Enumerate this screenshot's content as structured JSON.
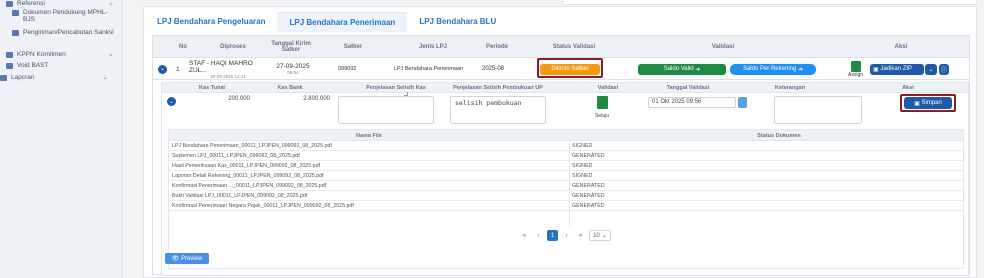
{
  "sidebar": {
    "items": [
      {
        "label": "Referensi",
        "has_chevron": true
      },
      {
        "label": "Dokumen Pendukung MPHL-BJS",
        "sub": true
      },
      {
        "label": "Pengiriman/Pencabutan Sanksi",
        "sub": true
      },
      {
        "label": "KPPN Komitmen",
        "has_chevron": true
      },
      {
        "label": "Void BAST"
      },
      {
        "label": "Lapcran",
        "has_chevron": true
      }
    ]
  },
  "tabs": [
    {
      "label": "LPJ Bendahara Pengeluaran",
      "active": false
    },
    {
      "label": "LPJ Bendahara Penerimaan",
      "active": true
    },
    {
      "label": "LPJ Bendahara BLU",
      "active": false
    }
  ],
  "main_table": {
    "headers": {
      "no": "No",
      "diproses": "Diproses",
      "tanggal_kirim": "Tanggal Kirim Satker",
      "satker": "Satker",
      "jenis_lpj": "Jenis LPJ",
      "periode": "Periode",
      "status_validasi": "Status Validasi",
      "validasi": "Validasi",
      "aksi": "Aksi"
    },
    "row": {
      "no": "1",
      "diproses_name": "STAF - HAQI MAHRO ZUL...",
      "diproses_date": "30-09-2025 14:41",
      "tanggal_kirim_date": "27-09-2025",
      "tanggal_kirim_time": "09:54",
      "satker": "099092",
      "jenis_lpj": "LPJ Bendahara Penerimaan",
      "periode": "2025-08",
      "status_validasi": "Dikirim Satker",
      "saldo_valid_btn": "Saldo Valid",
      "saldo_rekening_btn": "Saldo Per Rekening",
      "assign_label": "Assign",
      "jadikan_zip_btn": "Jadikan ZIP"
    }
  },
  "detail": {
    "headers": {
      "kas_tunai": "Kas Tunai",
      "kas_bank": "Kas Bank",
      "penjelasan_kas": "Penjelasan Selisih Kas",
      "penjelasan_up": "Penjelasan Selisih Pembukuan UP",
      "validasi": "Validasi",
      "tanggal_validasi": "Tanggal Validasi",
      "keterangan": "Keterangan",
      "aksi": "Aksi"
    },
    "row": {
      "kas_tunai": "200.000",
      "kas_bank": "2.800.000",
      "penjelasan_kas": "",
      "penjelasan_up": "selisih pembukuan",
      "validasi_label": "Setuju",
      "tanggal_validasi": "01 Okt 2025 09:56",
      "keterangan": "",
      "simpan_btn": "Simpan"
    }
  },
  "files": {
    "header_nama": "Nama File",
    "header_status": "Status Dokumen",
    "rows": [
      {
        "name": "LPJ Bendahara Penerimaan_00011_LPJPEN_099092_08_2025.pdf",
        "status": "SIGNED"
      },
      {
        "name": "Suplemen LPJ_00011_LPJPEN_099092_08_2025.pdf",
        "status": "GENERATED"
      },
      {
        "name": "Hasil Pemeriksaan Kas_00011_LPJPEN_099092_08_2025.pdf",
        "status": "SIGNED"
      },
      {
        "name": "Laporan Detail Rekening_00011_LPJPEN_099092_08_2025.pdf",
        "status": "SIGNED"
      },
      {
        "name": "Konfirmasi Penerimaan ..._00011_LPJPEN_099092_08_2025.pdf",
        "status": "GENERATED"
      },
      {
        "name": "Bukti Validasi LPJ_00011_LPJPEN_099092_08_2025.pdf",
        "status": "GENERATED"
      },
      {
        "name": "Konfirmasi Penerimaan Negara Pajak_00011_LPJPEN_099092_08_2025.pdf",
        "status": "GENERATED"
      }
    ],
    "pager": {
      "current": "1",
      "per_page": "10"
    }
  },
  "preview_btn": "Preview",
  "colors": {
    "primary": "#2872c5",
    "navy": "#1e5aa8",
    "green": "#1f8a44",
    "orange": "#f39c12",
    "highlight": "#8b1a2b"
  }
}
